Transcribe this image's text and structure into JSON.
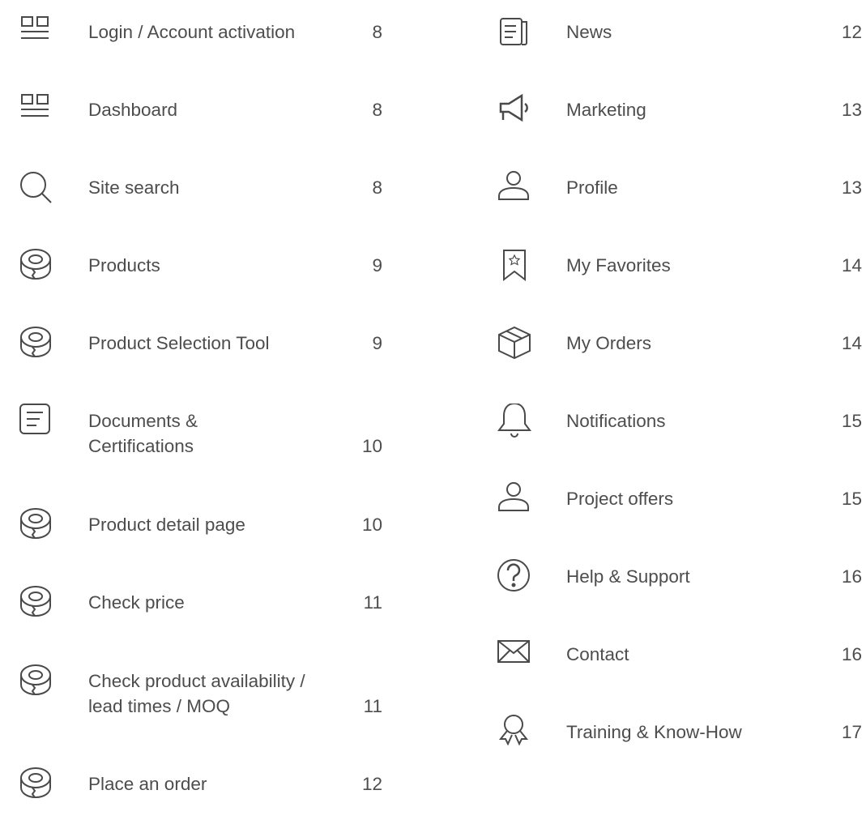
{
  "left_entries": [
    {
      "label": "Login / Account activation",
      "page": "8",
      "icon": "layout-icon"
    },
    {
      "label": "Dashboard",
      "page": "8",
      "icon": "layout-icon"
    },
    {
      "label": "Site search",
      "page": "8",
      "icon": "search-icon"
    },
    {
      "label": "Products",
      "page": "9",
      "icon": "tape-roll-icon"
    },
    {
      "label": "Product Selection Tool",
      "page": "9",
      "icon": "tape-roll-icon"
    },
    {
      "label": "Documents &\nCertifications",
      "page": "10",
      "icon": "document-icon"
    },
    {
      "label": "Product detail page",
      "page": "10",
      "icon": "tape-roll-icon"
    },
    {
      "label": "Check price",
      "page": "11",
      "icon": "tape-roll-icon"
    },
    {
      "label": "Check product availability /\nlead times / MOQ",
      "page": "11",
      "icon": "tape-roll-icon"
    },
    {
      "label": "Place an order",
      "page": "12",
      "icon": "tape-roll-icon"
    }
  ],
  "right_entries": [
    {
      "label": "News",
      "page": "12",
      "icon": "news-icon"
    },
    {
      "label": "Marketing",
      "page": "13",
      "icon": "megaphone-icon"
    },
    {
      "label": "Profile",
      "page": "13",
      "icon": "user-icon"
    },
    {
      "label": "My Favorites",
      "page": "14",
      "icon": "bookmark-star-icon"
    },
    {
      "label": "My Orders",
      "page": "14",
      "icon": "box-icon"
    },
    {
      "label": "Notifications",
      "page": "15",
      "icon": "bell-icon"
    },
    {
      "label": "Project offers",
      "page": "15",
      "icon": "user-icon"
    },
    {
      "label": "Help & Support",
      "page": "16",
      "icon": "question-icon"
    },
    {
      "label": "Contact",
      "page": "16",
      "icon": "envelope-icon"
    },
    {
      "label": "Training & Know-How",
      "page": "17",
      "icon": "award-icon"
    }
  ],
  "colors": {
    "icon_stroke": "#4a4a4a",
    "text": "#4d4d4d"
  }
}
